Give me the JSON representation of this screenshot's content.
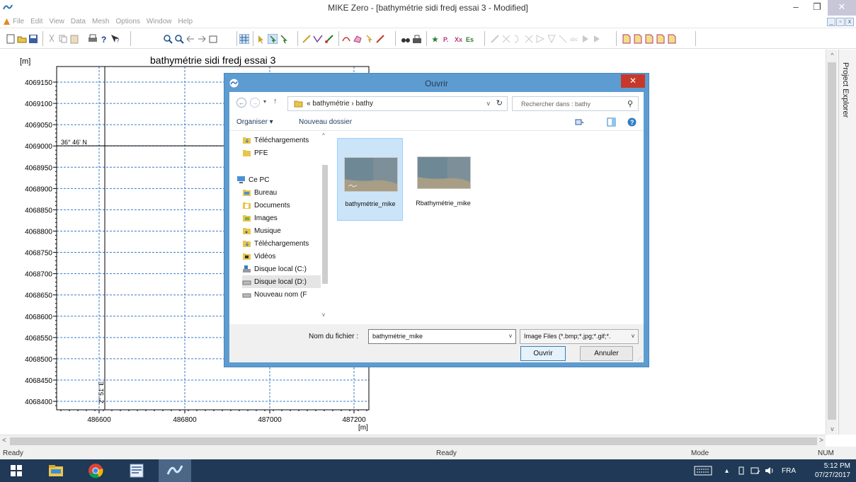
{
  "window": {
    "title": "MIKE Zero - [bathymétrie sidi fredj essai 3 - Modified]",
    "controls": {
      "minimize": "–",
      "restore": "❐",
      "close": "✕"
    }
  },
  "menu": {
    "items": [
      "File",
      "Edit",
      "View",
      "Data",
      "Mesh",
      "Options",
      "Window",
      "Help"
    ],
    "mdi": {
      "minimize": "_",
      "restore": "▫",
      "close": "x"
    }
  },
  "map": {
    "unit_top": "[m]",
    "title": "bathymétrie sidi fredj essai 3",
    "unit_bottom": "[m]",
    "y_ticks": [
      "4069150",
      "4069100",
      "4069050",
      "4069000",
      "4068950",
      "4068900",
      "4068850",
      "4068800",
      "4068750",
      "4068700",
      "4068650",
      "4068600",
      "4068550",
      "4068500",
      "4068450",
      "4068400"
    ],
    "x_ticks": [
      "486600",
      "486800",
      "487000",
      "487200"
    ],
    "lat_label": "36° 46' N",
    "lon_label": "2° 51' E"
  },
  "explorer": {
    "label": "Project Explorer"
  },
  "statusbar": {
    "left": "Ready",
    "center": "Ready",
    "mode": "Mode",
    "num": "NUM"
  },
  "taskbar": {
    "lang": "FRA",
    "time": "5:12 PM",
    "date": "07/27/2017"
  },
  "dialog": {
    "title": "Ouvrir",
    "close": "✕",
    "breadcrumb": [
      "«",
      "bathymétrie",
      "›",
      "bathy"
    ],
    "search_placeholder": "Rechercher dans : bathy",
    "organize": "Organiser ▾",
    "new_folder": "Nouveau dossier",
    "nav_items": [
      {
        "label": "Téléchargements",
        "icon": "download-folder-icon"
      },
      {
        "label": "PFE",
        "icon": "folder-icon"
      },
      {
        "label": "Ce PC",
        "icon": "computer-icon"
      },
      {
        "label": "Bureau",
        "icon": "desktop-folder-icon"
      },
      {
        "label": "Documents",
        "icon": "documents-folder-icon"
      },
      {
        "label": "Images",
        "icon": "pictures-folder-icon"
      },
      {
        "label": "Musique",
        "icon": "music-folder-icon"
      },
      {
        "label": "Téléchargements",
        "icon": "download-folder-icon"
      },
      {
        "label": "Vidéos",
        "icon": "videos-folder-icon"
      },
      {
        "label": "Disque local (C:)",
        "icon": "windows-drive-icon"
      },
      {
        "label": "Disque local (D:)",
        "icon": "drive-icon"
      },
      {
        "label": "Nouveau nom (F",
        "icon": "drive-icon"
      }
    ],
    "files": [
      {
        "name": "bathymétrie_mike",
        "selected": true
      },
      {
        "name": "Rbathymétrie_mike",
        "selected": false
      }
    ],
    "filename_label": "Nom du fichier :",
    "filename_value": "bathymétrie_mike",
    "filetype_value": "Image Files (*.bmp;*.jpg;*.gif;*.",
    "open_button": "Ouvrir",
    "cancel_button": "Annuler"
  },
  "colors": {
    "dialog_frame": "#5d9cd0",
    "taskbar": "#1f3956",
    "selection": "#cce4f7",
    "grid_line": "#3a7dc9"
  }
}
